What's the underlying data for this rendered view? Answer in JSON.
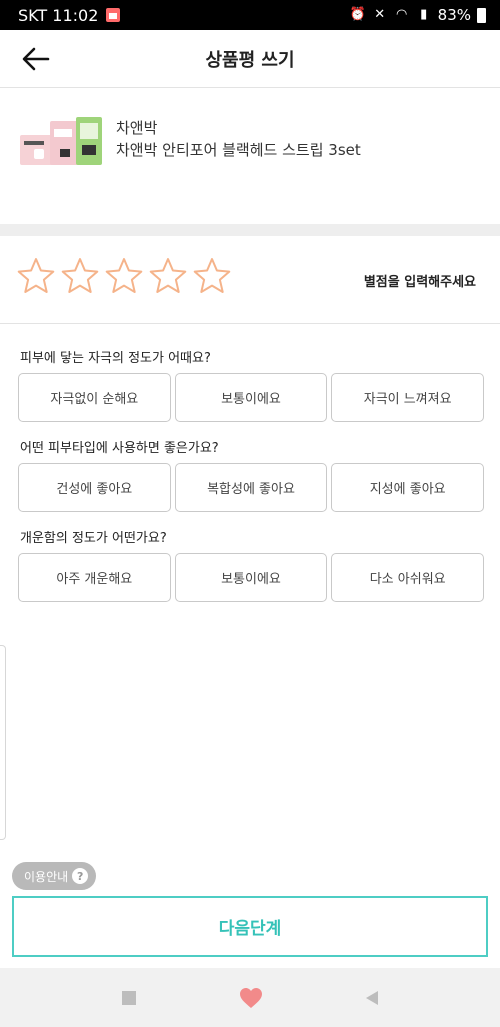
{
  "status_bar": {
    "carrier_time": "SKT 11:02",
    "battery": "83%",
    "icons": [
      "calendar-icon",
      "alarm-icon",
      "mute-icon",
      "wifi-icon",
      "signal-icon",
      "battery-icon"
    ]
  },
  "header": {
    "title": "상품평 쓰기",
    "back_icon": "back-arrow-icon"
  },
  "product": {
    "brand": "차앤박",
    "name": "차앤박 안티포어 블랙헤드 스트립 3set"
  },
  "rating": {
    "hint": "별점을 입력해주세요",
    "star_count": 5,
    "selected": 0,
    "star_color": "#f5b38a"
  },
  "questions": [
    {
      "label": "피부에 닿는 자극의 정도가 어때요?",
      "options": [
        "자극없이 순해요",
        "보통이에요",
        "자극이 느껴져요"
      ]
    },
    {
      "label": "어떤 피부타입에 사용하면 좋은가요?",
      "options": [
        "건성에 좋아요",
        "복합성에 좋아요",
        "지성에 좋아요"
      ]
    },
    {
      "label": "개운함의 정도가 어떤가요?",
      "options": [
        "아주 개운해요",
        "보통이에요",
        "다소 아쉬워요"
      ]
    }
  ],
  "info_badge": "이용안내",
  "next_button": "다음단계",
  "colors": {
    "accent": "#35c2b8",
    "star": "#f5b38a"
  }
}
